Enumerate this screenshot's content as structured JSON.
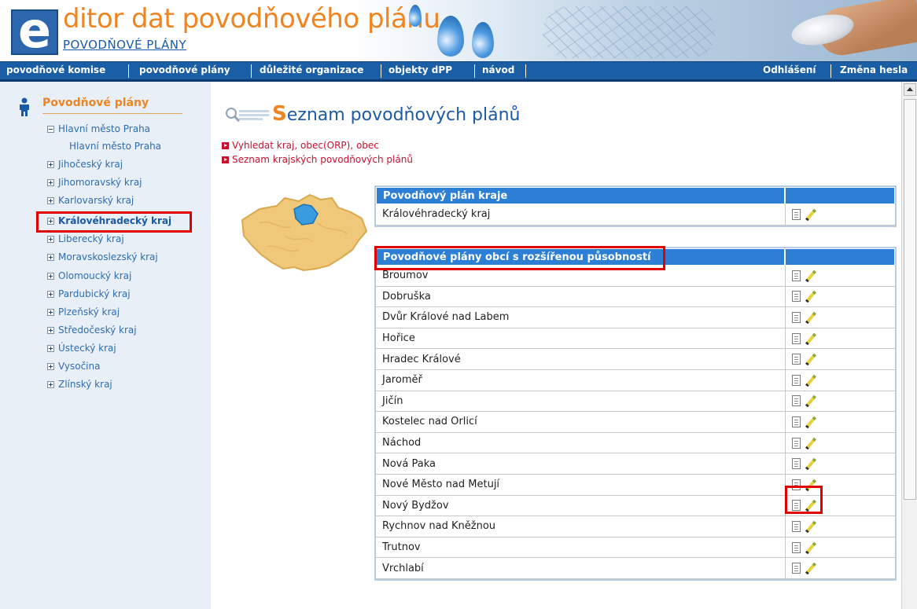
{
  "header": {
    "logo_letter": "e",
    "title": "ditor dat povodňového plánu",
    "subtitle": "POVODŇOVÉ PLÁNY"
  },
  "navbar": {
    "items": [
      "povodňové komise",
      "povodňové plány",
      "důležité organizace",
      "objekty dPP",
      "návod"
    ],
    "right_items": [
      "Odhlášení",
      "Změna hesla"
    ]
  },
  "sidebar": {
    "title": "Povodňové plány",
    "tree": [
      {
        "label": "Hlavní město Praha",
        "expanded": true
      },
      {
        "label": "Hlavní město Praha",
        "child": true
      },
      {
        "label": "Jihočeský kraj"
      },
      {
        "label": "Jihomoravský kraj"
      },
      {
        "label": "Karlovarský kraj"
      },
      {
        "label": "Královéhradecký kraj",
        "selected": true
      },
      {
        "label": "Liberecký kraj"
      },
      {
        "label": "Moravskoslezský kraj"
      },
      {
        "label": "Olomoucký kraj"
      },
      {
        "label": "Pardubický kraj"
      },
      {
        "label": "Plzeňský kraj"
      },
      {
        "label": "Středočeský kraj"
      },
      {
        "label": "Ústecký kraj"
      },
      {
        "label": "Vysočina"
      },
      {
        "label": "Zlínský kraj"
      }
    ]
  },
  "main": {
    "title_first_letter": "S",
    "title_rest": "eznam povodňových plánů",
    "links": [
      "Vyhledat kraj, obec(ORP), obec",
      "Seznam krajských povodňových plánů"
    ],
    "region_table": {
      "header": "Povodňový plán kraje",
      "rows": [
        "Královéhradecký kraj"
      ]
    },
    "orp_table": {
      "header": "Povodňové plány obcí s rozšířenou působností",
      "rows": [
        "Broumov",
        "Dobruška",
        "Dvůr Králové nad Labem",
        "Hořice",
        "Hradec Králové",
        "Jaroměř",
        "Jičín",
        "Kostelec nad Orlicí",
        "Náchod",
        "Nová Paka",
        "Nové Město nad Metují",
        "Nový Bydžov",
        "Rychnov nad Kněžnou",
        "Trutnov",
        "Vrchlabí"
      ]
    }
  },
  "colors": {
    "nav_bg": "#1a5fa6",
    "accent_orange": "#ef8420",
    "table_header": "#2c7fd4",
    "highlight_red": "#e00000",
    "link_red": "#c8102e"
  },
  "icons": {
    "view": "document-icon",
    "edit": "pencil-edit-icon"
  }
}
